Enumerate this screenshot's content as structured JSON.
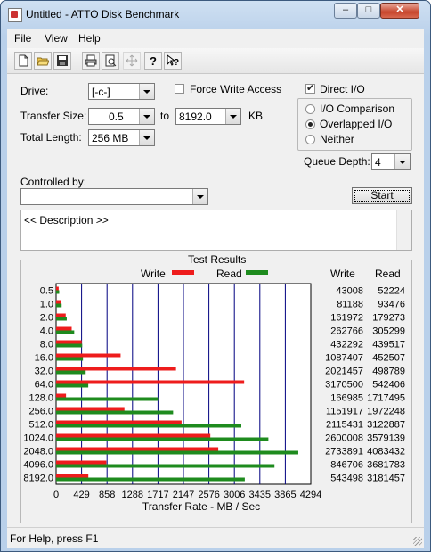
{
  "window": {
    "title": "Untitled - ATTO Disk Benchmark"
  },
  "menubar": {
    "items": [
      "File",
      "View",
      "Help"
    ]
  },
  "toolbar": {
    "icons": [
      "new-file-icon",
      "open-folder-icon",
      "save-disk-icon",
      "print-icon",
      "print-preview-icon",
      "move-icon",
      "help-icon",
      "context-help-icon"
    ]
  },
  "settings": {
    "drive_label": "Drive:",
    "drive_value": "[-c-]",
    "force_write_label": "Force Write Access",
    "force_write_checked": false,
    "direct_io_label": "Direct I/O",
    "direct_io_checked": true,
    "transfer_size_label": "Transfer Size:",
    "transfer_from": "0.5",
    "transfer_to_word": "to",
    "transfer_to": "8192.0",
    "transfer_unit": "KB",
    "total_length_label": "Total Length:",
    "total_length_value": "256 MB",
    "io_options": [
      "I/O Comparison",
      "Overlapped I/O",
      "Neither"
    ],
    "io_selected": "Overlapped I/O",
    "queue_depth_label": "Queue Depth:",
    "queue_depth_value": "4",
    "controlled_by_label": "Controlled by:",
    "controlled_by_value": "",
    "start_label": "Start"
  },
  "description": {
    "text": "<< Description >>"
  },
  "results": {
    "caption": "Test Results",
    "legend_write": "Write",
    "legend_read": "Read",
    "col_write": "Write",
    "col_read": "Read"
  },
  "colors": {
    "write": "#ee1c1c",
    "read": "#1e8b1e",
    "grid": "#000080"
  },
  "chart_data": {
    "type": "bar",
    "orientation": "horizontal",
    "categories": [
      "0.5",
      "1.0",
      "2.0",
      "4.0",
      "8.0",
      "16.0",
      "32.0",
      "64.0",
      "128.0",
      "256.0",
      "512.0",
      "1024.0",
      "2048.0",
      "4096.0",
      "8192.0"
    ],
    "series": [
      {
        "name": "Write",
        "values": [
          43008,
          81188,
          161972,
          262766,
          432292,
          1087407,
          2021457,
          3170500,
          166985,
          1151917,
          2115431,
          2600008,
          2733891,
          846706,
          543498
        ]
      },
      {
        "name": "Read",
        "values": [
          52224,
          93476,
          179273,
          305299,
          439517,
          452507,
          498789,
          542406,
          1717495,
          1972248,
          3122887,
          3579139,
          4083432,
          3681783,
          3181457
        ]
      }
    ],
    "xlabel": "Transfer Rate - MB / Sec",
    "xticks": [
      "0",
      "429",
      "858",
      "1288",
      "1717",
      "2147",
      "2576",
      "3006",
      "3435",
      "3865",
      "4294"
    ],
    "xlim": [
      0,
      4294
    ],
    "legend": "top",
    "grid": true
  },
  "status": {
    "text": "For Help, press F1"
  }
}
